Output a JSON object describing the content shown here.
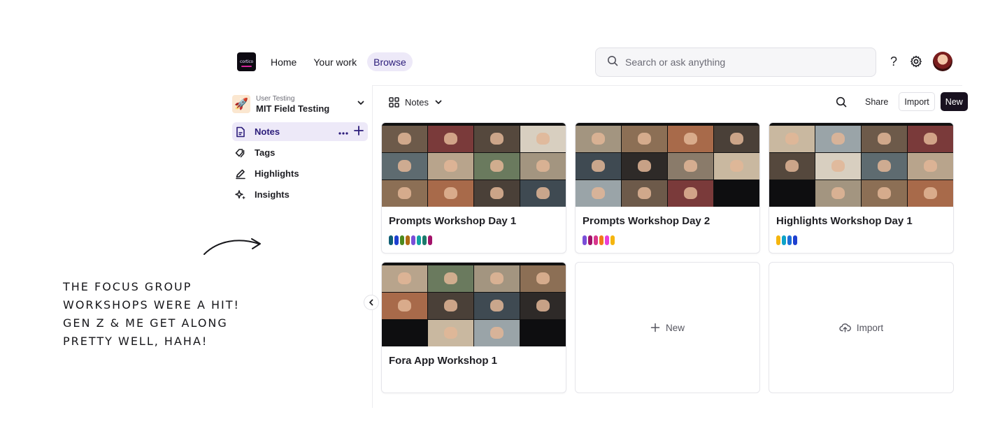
{
  "logo": {
    "text": "cortico"
  },
  "nav": {
    "items": [
      {
        "label": "Home"
      },
      {
        "label": "Your work"
      },
      {
        "label": "Browse"
      }
    ],
    "active": "Browse"
  },
  "search": {
    "placeholder": "Search or ask anything"
  },
  "top_icons": {
    "help": "?",
    "settings": "gear-icon",
    "avatar": "avatar"
  },
  "workspace": {
    "subtitle": "User Testing",
    "title": "MIT Field Testing",
    "icon": "rocket-icon"
  },
  "sidebar": {
    "items": [
      {
        "label": "Notes",
        "icon": "note-icon",
        "active": true
      },
      {
        "label": "Tags",
        "icon": "tag-icon"
      },
      {
        "label": "Highlights",
        "icon": "highlighter-icon"
      },
      {
        "label": "Insights",
        "icon": "sparkle-icon"
      }
    ]
  },
  "note": {
    "lines": [
      "The focus group",
      "workshops were a hit!",
      "Gen Z & me get along",
      "pretty well, haha!"
    ]
  },
  "toolbar": {
    "view_label": "Notes",
    "share_label": "Share",
    "import_label": "Import",
    "new_label": "New"
  },
  "cards": [
    {
      "title": "Prompts Workshop Day 1",
      "tags": [
        "#0f5f75",
        "#1e3fd0",
        "#4c8a1e",
        "#b06a12",
        "#7a4fd8",
        "#0fa3a3",
        "#1b7a6a",
        "#a3126a"
      ]
    },
    {
      "title": "Prompts Workshop Day 2",
      "tags": [
        "#7a4fd8",
        "#a3126a",
        "#d9368c",
        "#f07a1a",
        "#e83fd8",
        "#f5b50f"
      ]
    },
    {
      "title": "Highlights Workshop Day 1",
      "tags": [
        "#f5b50f",
        "#0fa3c8",
        "#1e6fd8",
        "#1e3fd0"
      ]
    },
    {
      "title": "Fora App Workshop 1",
      "tags": []
    }
  ],
  "actions": {
    "new_label": "New",
    "import_label": "Import"
  },
  "colors": {
    "accent": "#2b1c7a",
    "accent_bg": "#ede9f8",
    "primary_button": "#18111f"
  }
}
